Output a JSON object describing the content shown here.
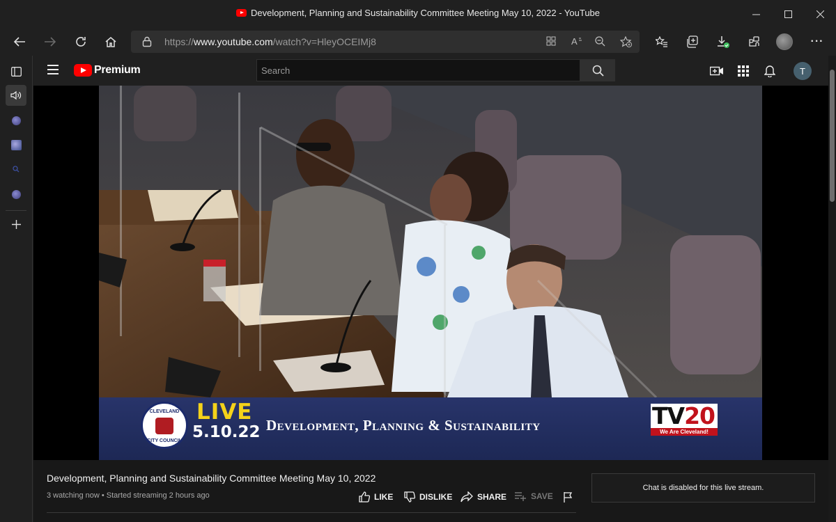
{
  "window": {
    "title": "Development, Planning and Sustainability Committee Meeting May 10, 2022 - YouTube",
    "minimize": "—",
    "maximize": "☐",
    "close": "✕"
  },
  "toolbar": {
    "url_prefix": "https://",
    "url_domain": "www.youtube.com",
    "url_path": "/watch?v=HleyOCEIMj8",
    "more": "···"
  },
  "youtube": {
    "brand": "Premium",
    "search_placeholder": "Search",
    "avatar_letter": "T"
  },
  "video": {
    "seal_top": "CLEVELAND",
    "seal_bottom": "CITY COUNCIL",
    "live_label": "LIVE",
    "date": "5.10.22",
    "overlay_title": "Development, Planning & Sustainability",
    "channel_logo": "TV",
    "channel_logo_num": "20",
    "channel_tagline": "We Are Cleveland!"
  },
  "details": {
    "title": "Development, Planning and Sustainability Committee Meeting May 10, 2022",
    "meta": "3 watching now • Started streaming 2 hours ago",
    "like": "LIKE",
    "dislike": "DISLIKE",
    "share": "SHARE",
    "save": "SAVE"
  },
  "chat": {
    "disabled_text": "Chat is disabled for this live stream."
  },
  "colors": {
    "yt_red": "#ff0000",
    "banner_blue": "#28346a",
    "live_yellow": "#f4d21a"
  }
}
